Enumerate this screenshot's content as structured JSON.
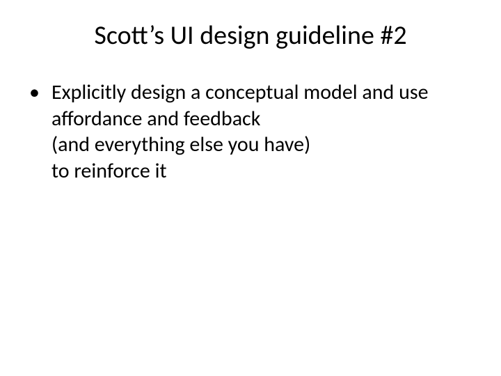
{
  "slide": {
    "title": "Scott’s UI design guideline #2",
    "bullets": [
      "Explicitly design a conceptual model and use affordance and feedback\n(and everything else you have)\nto reinforce it"
    ]
  }
}
